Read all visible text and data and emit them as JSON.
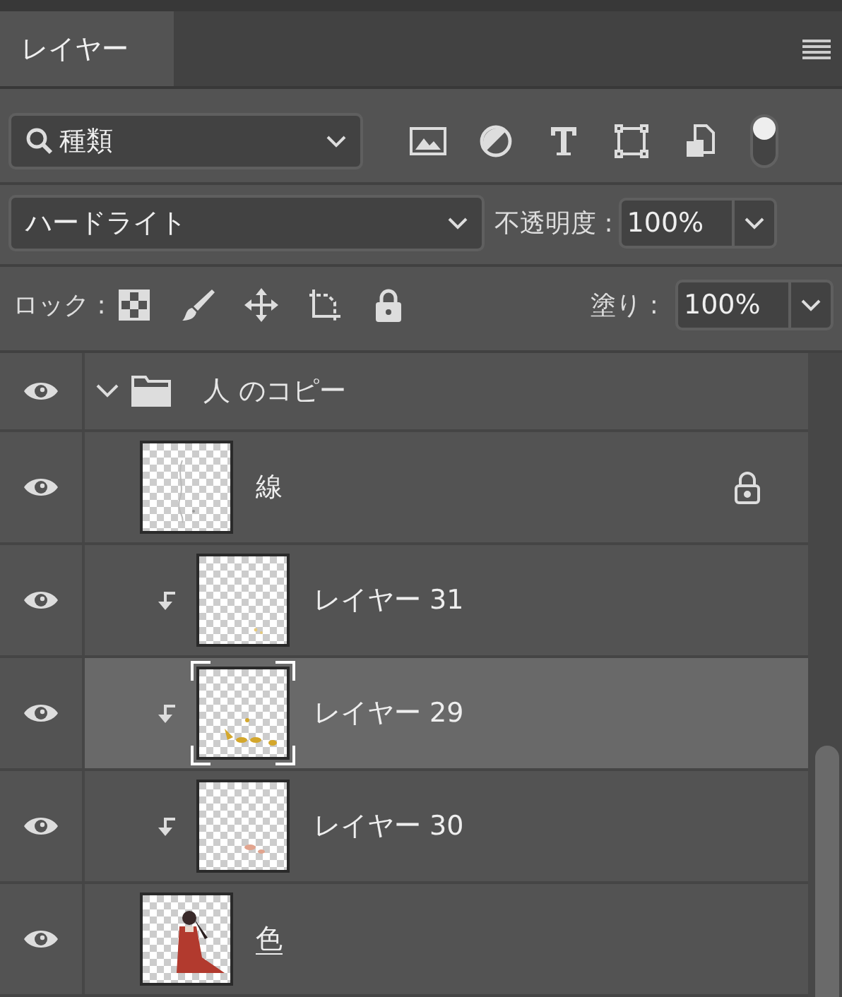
{
  "tabs": [
    {
      "label": "レイヤー",
      "selected": true
    }
  ],
  "filter": {
    "kind_label": "種類",
    "toggle_on": true
  },
  "blend": {
    "mode": "ハードライト",
    "opacity_label": "不透明度 :",
    "opacity": "100%"
  },
  "lock": {
    "label": "ロック :",
    "fill_label": "塗り :",
    "fill": "100%"
  },
  "layers": [
    {
      "kind": "group",
      "name": "人 のコピー",
      "visible": true,
      "expanded": true,
      "selected": false,
      "children": [
        {
          "kind": "layer",
          "name": "線",
          "visible": true,
          "clipped": false,
          "locked": true,
          "selected": false,
          "underlined": false
        },
        {
          "kind": "layer",
          "name": "レイヤー 31",
          "visible": true,
          "clipped": true,
          "locked": false,
          "selected": false,
          "underlined": false
        },
        {
          "kind": "layer",
          "name": "レイヤー 29",
          "visible": true,
          "clipped": true,
          "locked": false,
          "selected": true,
          "underlined": false
        },
        {
          "kind": "layer",
          "name": "レイヤー 30",
          "visible": true,
          "clipped": true,
          "locked": false,
          "selected": false,
          "underlined": false
        },
        {
          "kind": "layer",
          "name": "色",
          "visible": true,
          "clipped": false,
          "locked": false,
          "selected": false,
          "underlined": true
        }
      ]
    }
  ]
}
